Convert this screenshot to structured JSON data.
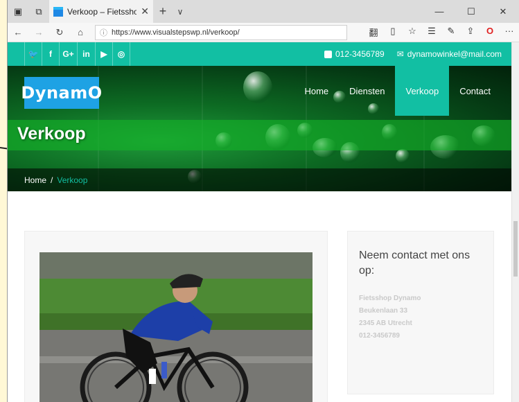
{
  "browser": {
    "tab_title": "Verkoop – Fietsshop Dy",
    "tab_close": "✕",
    "new_tab": "+",
    "tab_menu": "∨",
    "url": "https://www.visualstepswp.nl/verkoop/",
    "win_minimize": "—",
    "win_maximize": "☐",
    "win_close": "✕",
    "nav_back": "←",
    "nav_forward": "→",
    "nav_refresh": "↻",
    "nav_home": "⌂",
    "tool_icons": [
      "翻",
      "▯",
      "☆",
      "☰",
      "✎",
      "⇪",
      "O",
      "···"
    ]
  },
  "topbar": {
    "social": [
      {
        "icon": "twitter-icon",
        "glyph": "🐦"
      },
      {
        "icon": "facebook-icon",
        "glyph": "f"
      },
      {
        "icon": "google-plus-icon",
        "glyph": "G+"
      },
      {
        "icon": "linkedin-icon",
        "glyph": "in"
      },
      {
        "icon": "youtube-icon",
        "glyph": "▶"
      },
      {
        "icon": "instagram-icon",
        "glyph": "◎"
      }
    ],
    "phone": "012-3456789",
    "email": "dynamowinkel@mail.com"
  },
  "header": {
    "logo": "DynamO",
    "nav": [
      "Home",
      "Diensten",
      "Verkoop",
      "Contact"
    ],
    "active_nav": "Verkoop"
  },
  "hero": {
    "title": "Verkoop",
    "breadcrumb_home": "Home",
    "breadcrumb_sep": "/",
    "breadcrumb_current": "Verkoop"
  },
  "sidebar": {
    "heading": "Neem contact met ons op:",
    "address_lines": [
      "Fietsshop Dynamo",
      "Beukenlaan 33",
      "2345 AB Utrecht",
      "012-3456789"
    ]
  },
  "colors": {
    "accent": "#12bfa3",
    "logo_bg": "#1ea2e4"
  }
}
